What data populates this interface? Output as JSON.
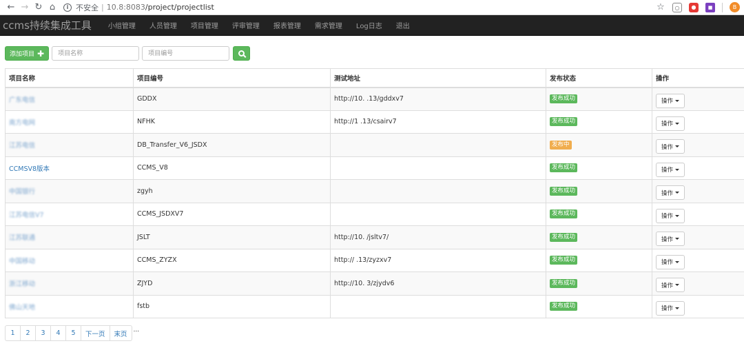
{
  "browser": {
    "insecure_label": "不安全",
    "url_host": "10.",
    "url_port": "8:8083",
    "url_path": "/project/projectlist",
    "avatar_letter": "B"
  },
  "navbar": {
    "brand": "ccms持续集成工具",
    "items": [
      "小组管理",
      "人员管理",
      "项目管理",
      "评审管理",
      "报表管理",
      "需求管理",
      "Log日志",
      "退出"
    ]
  },
  "toolbar": {
    "add_label": "添加项目",
    "name_placeholder": "项目名称",
    "code_placeholder": "项目编号"
  },
  "table": {
    "headers": [
      "项目名称",
      "项目编号",
      "测试地址",
      "发布状态",
      "操作"
    ],
    "ops_label": "操作",
    "rows": [
      {
        "name": "广东电信",
        "blurred": true,
        "code": "GDDX",
        "url": "http://10.   .13/gddxv7",
        "status": "发布成功",
        "status_type": "success"
      },
      {
        "name": "南方电网",
        "blurred": true,
        "code": "NFHK",
        "url": "http://1    .13/csairv7",
        "status": "发布成功",
        "status_type": "success"
      },
      {
        "name": "江苏电信",
        "blurred": true,
        "code": "DB_Transfer_V6_JSDX",
        "url": "",
        "status": "发布中",
        "status_type": "warning"
      },
      {
        "name": "CCMSV8版本",
        "blurred": false,
        "code": "CCMS_V8",
        "url": "",
        "status": "发布成功",
        "status_type": "success"
      },
      {
        "name": "中国银行",
        "blurred": true,
        "code": "zgyh",
        "url": "",
        "status": "发布成功",
        "status_type": "success"
      },
      {
        "name": "江苏电信V7",
        "blurred": true,
        "code": "CCMS_JSDXV7",
        "url": "",
        "status": "发布成功",
        "status_type": "success"
      },
      {
        "name": "江苏联通",
        "blurred": true,
        "code": "JSLT",
        "url": "http://10.    /jsltv7/",
        "status": "发布成功",
        "status_type": "success"
      },
      {
        "name": "中国移动",
        "blurred": true,
        "code": "CCMS_ZYZX",
        "url": "http://   .13/zyzxv7",
        "status": "发布成功",
        "status_type": "success"
      },
      {
        "name": "浙江移动",
        "blurred": true,
        "code": "ZJYD",
        "url": "http://10.    3/zjydv6",
        "status": "发布成功",
        "status_type": "success"
      },
      {
        "name": "佛山天地",
        "blurred": true,
        "code": "fstb",
        "url": "",
        "status": "发布成功",
        "status_type": "success"
      }
    ]
  },
  "pagination": {
    "pages": [
      "1",
      "2",
      "3",
      "4",
      "5"
    ],
    "next_label": "下一页",
    "last_label": "末页",
    "ellipsis": "..."
  },
  "colors": {
    "primary_green": "#5cb85c",
    "warning_orange": "#f0ad4e",
    "link_blue": "#337ab7",
    "navbar_bg": "#222222"
  }
}
